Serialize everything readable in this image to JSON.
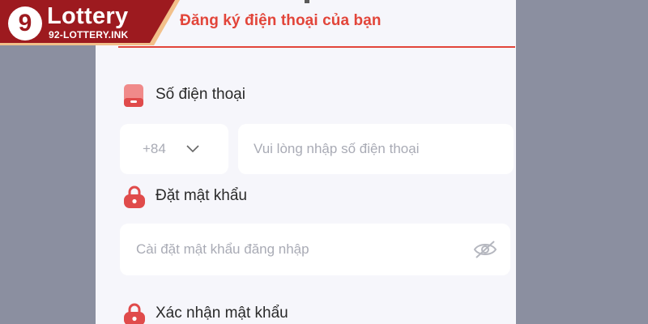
{
  "brand": {
    "logo_letter": "9",
    "name": "Lottery",
    "domain": "92-LOTTERY.INK",
    "color": "#9d1a1f"
  },
  "header": {
    "title": "Đăng ký điện thoại của bạn",
    "accent": "#e2453a"
  },
  "phone": {
    "label": "Số điện thoại",
    "country_code": "+84",
    "placeholder": "Vui lòng nhập số điện thoại",
    "icon": "phone-icon"
  },
  "password": {
    "label": "Đặt mật khẩu",
    "placeholder": "Cài đặt mật khẩu đăng nhập",
    "icon": "lock-icon",
    "toggle_icon": "eye-off-icon"
  },
  "confirm": {
    "label": "Xác nhận mật khẩu",
    "icon": "lock-icon"
  }
}
